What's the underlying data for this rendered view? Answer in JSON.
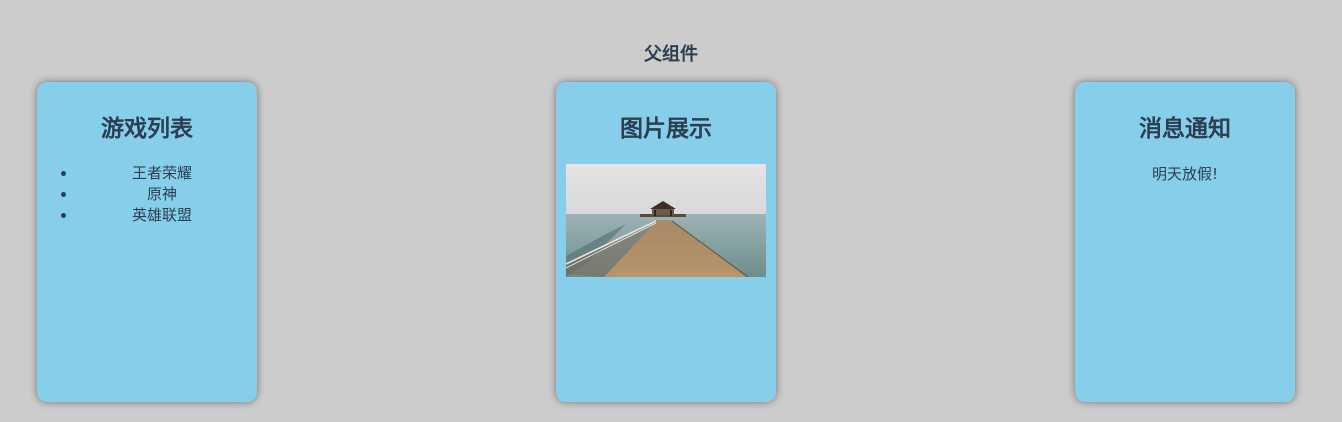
{
  "page": {
    "title": "父组件"
  },
  "cards": {
    "games": {
      "title": "游戏列表",
      "items": [
        "王者荣耀",
        "原神",
        "英雄联盟"
      ]
    },
    "images": {
      "title": "图片展示",
      "image": "pier-over-sea-photo"
    },
    "news": {
      "title": "消息通知",
      "message": "明天放假!"
    }
  },
  "colors": {
    "background": "#cccccc",
    "card": "#87ceeb",
    "text": "#2c3e50"
  }
}
